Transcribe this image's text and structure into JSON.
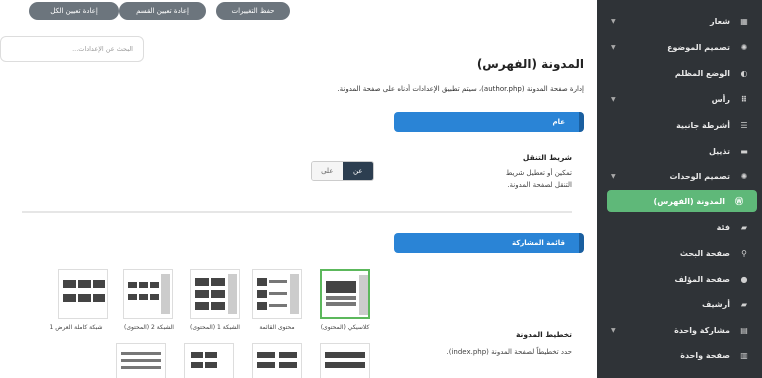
{
  "top_buttons": {
    "save": "حفظ التغييرات",
    "reset_section": "إعادة تعيين القسم",
    "reset_all": "إعادة تعيين الكل"
  },
  "search": {
    "placeholder": "البحث عن الإعدادات..."
  },
  "page": {
    "title": "المدونة (الفهرس)",
    "description": "إدارة صفحة المدونة (author.php)، سيتم تطبيق الإعدادات أدناه على صفحة المدونة."
  },
  "sections": {
    "general": "عام",
    "shared_list": "قائمة المشاركة"
  },
  "breadcrumb_setting": {
    "label": "شريط التنقل",
    "description": "تمكين أو تعطيل شريط التنقل لصفحة المدونة.",
    "on": "عن",
    "off": "على"
  },
  "layout_setting": {
    "label": "تخطيط المدونة",
    "description": "حدد تخطيطاً لصفحة المدونة (index.php)."
  },
  "layouts": [
    {
      "label": "كلاسيكي (المحتوى)",
      "selected": true
    },
    {
      "label": "محتوى القائمة",
      "selected": false
    },
    {
      "label": "الشبكة 1 (المحتوى)",
      "selected": false
    },
    {
      "label": "الشبكة 2 (المحتوى)",
      "selected": false
    },
    {
      "label": "شبكة كاملة العرض 1",
      "selected": false
    }
  ],
  "sidebar": {
    "items": [
      {
        "label": "شعار",
        "icon": "grid-icon",
        "chevron": true
      },
      {
        "label": "تصميم الموضوع",
        "icon": "bulb-icon",
        "chevron": true
      },
      {
        "label": "الوضع المظلم",
        "icon": "half-circle-icon",
        "chevron": false
      },
      {
        "label": "رأس",
        "icon": "dots-icon",
        "chevron": true
      },
      {
        "label": "أشرطة جانبية",
        "icon": "sidebar-icon",
        "chevron": false
      },
      {
        "label": "تذييل",
        "icon": "footer-icon",
        "chevron": false
      },
      {
        "label": "تصميم الوحدات",
        "icon": "bulb-icon",
        "chevron": true
      },
      {
        "label": "المدونة (الفهرس)",
        "icon": "wordpress-icon",
        "chevron": false,
        "active": true
      },
      {
        "label": "فئة",
        "icon": "folder-icon",
        "chevron": false
      },
      {
        "label": "صفحة البحث",
        "icon": "search-icon",
        "chevron": false
      },
      {
        "label": "صفحة المؤلف",
        "icon": "user-icon",
        "chevron": false
      },
      {
        "label": "أرشيف",
        "icon": "folder-icon",
        "chevron": false
      },
      {
        "label": "مشاركة واحدة",
        "icon": "doc-icon",
        "chevron": true
      },
      {
        "label": "صفحة واحدة",
        "icon": "page-icon",
        "chevron": false
      }
    ]
  },
  "colors": {
    "accent": "#2a84d6",
    "sidebar_bg": "#2f3337",
    "active": "#5fb879"
  }
}
